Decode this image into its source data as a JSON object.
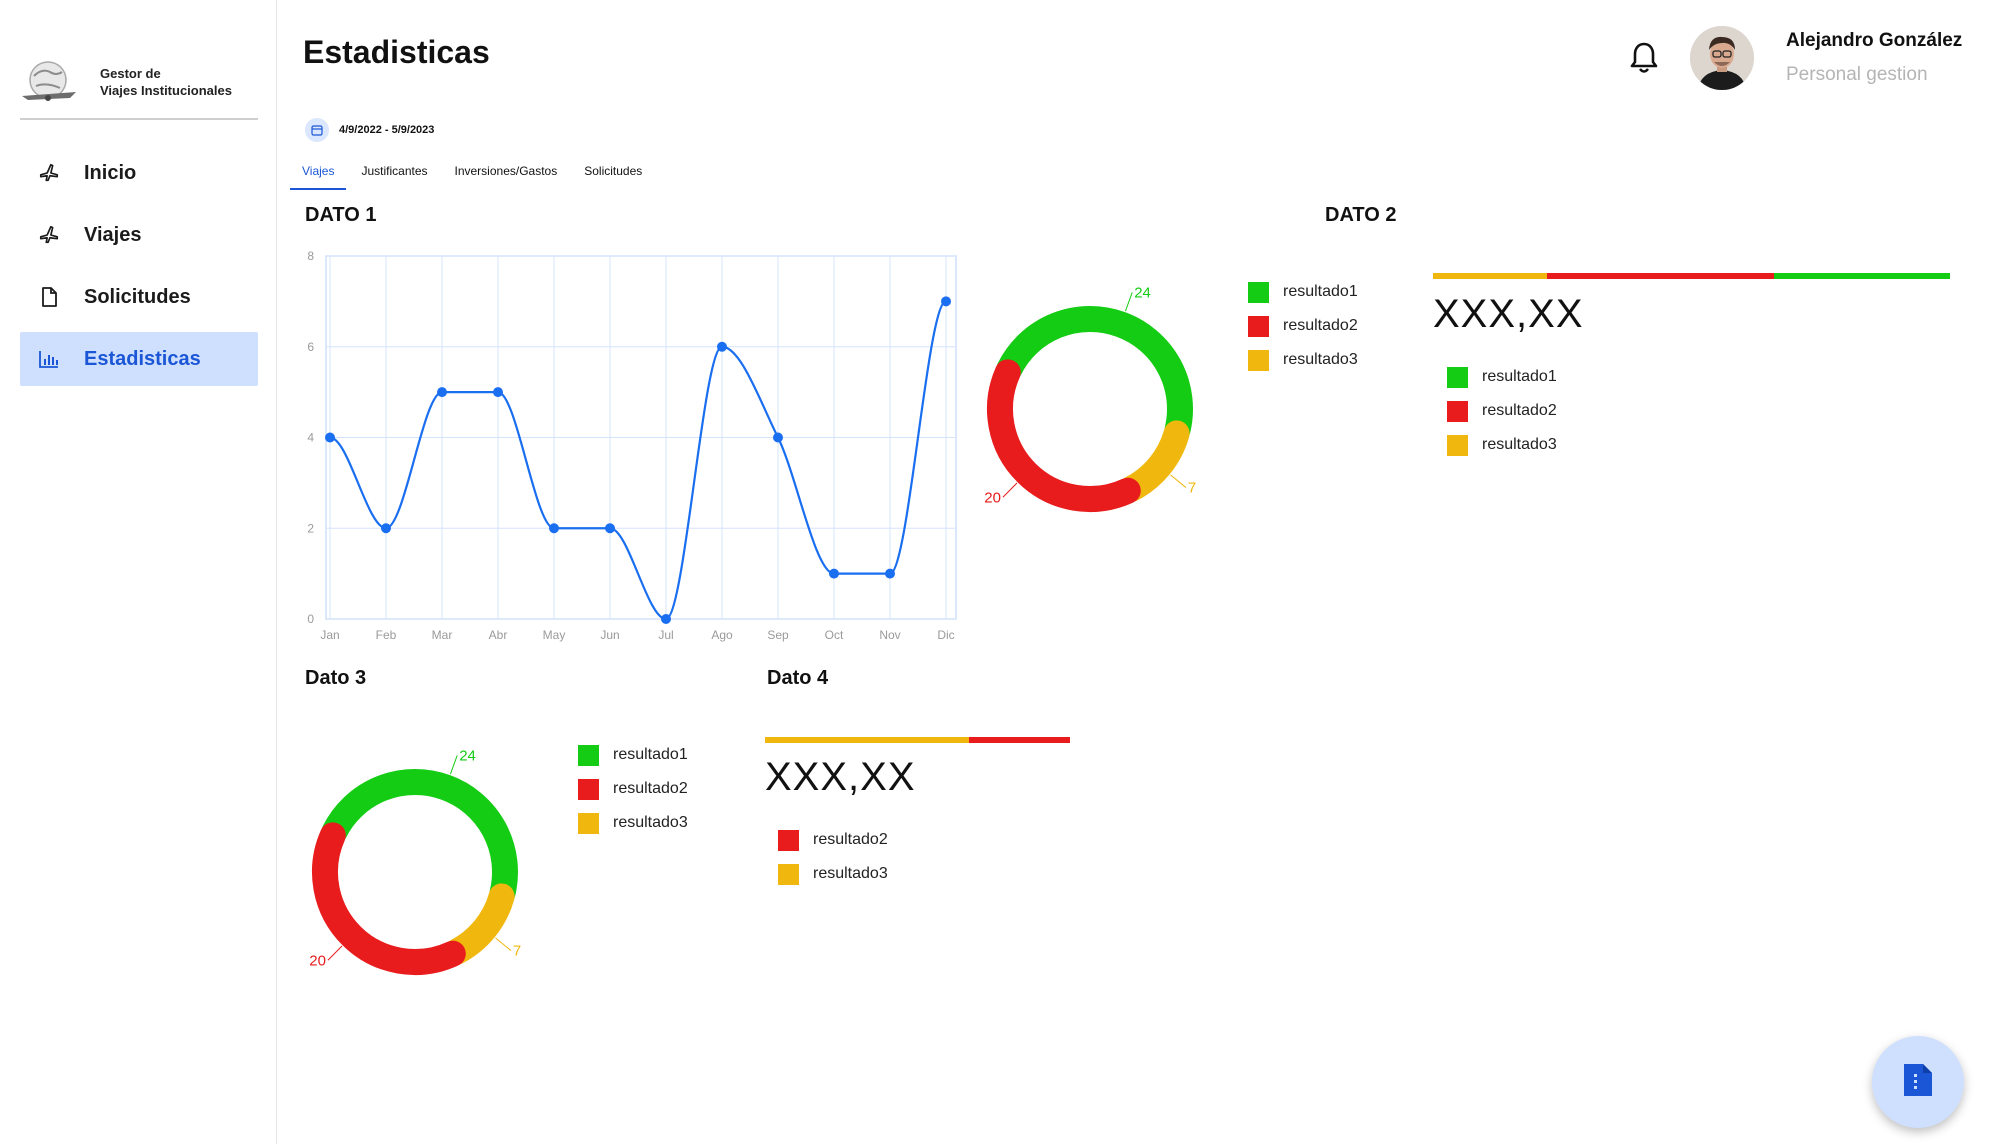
{
  "app": {
    "logo_line1": "Gestor de",
    "logo_line2": "Viajes Institucionales"
  },
  "sidebar": {
    "items": [
      {
        "label": "Inicio",
        "icon": "plane-icon"
      },
      {
        "label": "Viajes",
        "icon": "plane-icon"
      },
      {
        "label": "Solicitudes",
        "icon": "document-icon"
      },
      {
        "label": "Estadisticas",
        "icon": "bar-chart-icon",
        "active": true
      }
    ]
  },
  "header": {
    "title": "Estadisticas",
    "user_name": "Alejandro González",
    "user_role": "Personal gestion"
  },
  "date_range": "4/9/2022 - 5/9/2023",
  "tabs": [
    {
      "label": "Viajes",
      "active": true
    },
    {
      "label": "Justificantes"
    },
    {
      "label": "Inversiones/Gastos"
    },
    {
      "label": "Solicitudes"
    }
  ],
  "sections": {
    "dato1": "DATO 1",
    "dato2": "DATO 2",
    "dato3": "Dato 3",
    "dato4": "Dato 4"
  },
  "colors": {
    "green": "#15cc15",
    "red": "#e81c1c",
    "yellow": "#f0b80e",
    "line": "#1a6ef0",
    "accent": "#1a56d6"
  },
  "chart_data": [
    {
      "type": "line",
      "categories": [
        "Jan",
        "Feb",
        "Mar",
        "Abr",
        "May",
        "Jun",
        "Jul",
        "Ago",
        "Sep",
        "Oct",
        "Nov",
        "Dic"
      ],
      "values": [
        4,
        2,
        5,
        5,
        2,
        2,
        0,
        6,
        4,
        1,
        1,
        7
      ],
      "ylim": [
        0,
        8
      ],
      "yticks": [
        0,
        2,
        4,
        6,
        8
      ],
      "grid": true
    },
    {
      "type": "pie",
      "labels": [
        "resultado1",
        "resultado2",
        "resultado3"
      ],
      "values": [
        24,
        20,
        7
      ],
      "value_labels": [
        "24",
        "20",
        "7"
      ]
    },
    {
      "type": "pie",
      "labels": [
        "resultado1",
        "resultado2",
        "resultado3"
      ],
      "values": [
        24,
        20,
        7
      ],
      "value_labels": [
        "24",
        "20",
        "7"
      ]
    }
  ],
  "dato2_summary": {
    "value": "XXX,XX",
    "legend": [
      "resultado1",
      "resultado2",
      "resultado3"
    ],
    "bar_fractions": [
      0.22,
      0.44,
      0.34
    ]
  },
  "dato4_summary": {
    "value": "XXX,XX",
    "legend": [
      "resultado2",
      "resultado3"
    ],
    "bar_fractions": [
      0.67,
      0.33
    ]
  },
  "donut_legend": [
    "resultado1",
    "resultado2",
    "resultado3"
  ]
}
